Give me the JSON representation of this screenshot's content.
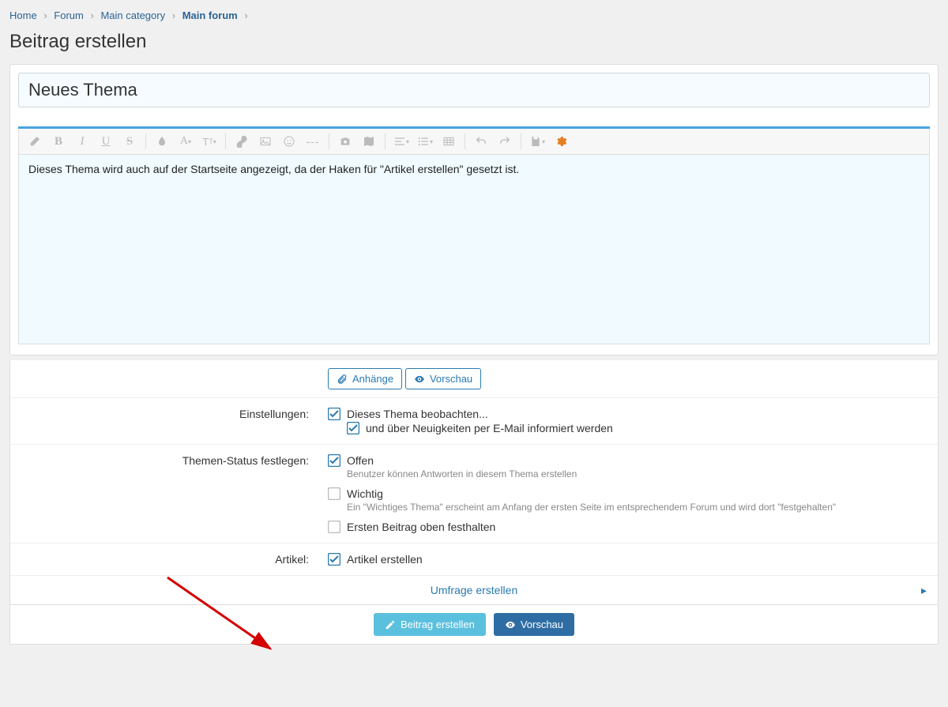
{
  "breadcrumb": {
    "items": [
      {
        "label": "Home"
      },
      {
        "label": "Forum"
      },
      {
        "label": "Main category"
      },
      {
        "label": "Main forum",
        "current": true
      }
    ]
  },
  "page_title": "Beitrag erstellen",
  "subject": {
    "value": "Neues Thema"
  },
  "editor": {
    "content": "Dieses Thema wird auch auf der Startseite angezeigt, da der Haken für \"Artikel erstellen\" gesetzt ist."
  },
  "buttons": {
    "attachments": "Anhänge",
    "preview_small": "Vorschau",
    "submit": "Beitrag erstellen",
    "preview_footer": "Vorschau"
  },
  "sections": {
    "settings_label": "Einstellungen:",
    "status_label": "Themen-Status festlegen:",
    "article_label": "Artikel:",
    "survey_label": "Umfrage erstellen"
  },
  "options": {
    "watch": {
      "label": "Dieses Thema beobachten...",
      "checked": true
    },
    "email": {
      "label": "und über Neuigkeiten per E-Mail informiert werden",
      "checked": true
    },
    "open": {
      "label": "Offen",
      "desc": "Benutzer können Antworten in diesem Thema erstellen",
      "checked": true
    },
    "important": {
      "label": "Wichtig",
      "desc": "Ein \"Wichtiges Thema\" erscheint am Anfang der ersten Seite im entsprechendem Forum und wird dort \"festgehalten\"",
      "checked": false
    },
    "pin_first": {
      "label": "Ersten Beitrag oben festhalten",
      "checked": false
    },
    "create_article": {
      "label": "Artikel erstellen",
      "checked": true
    }
  },
  "toolbar_icons": [
    "eraser",
    "bold",
    "italic",
    "underline",
    "strike",
    "sep",
    "drop",
    "font-color",
    "font-size",
    "sep",
    "link",
    "image",
    "smiley",
    "hr",
    "sep",
    "camera",
    "map",
    "sep",
    "align",
    "list",
    "table",
    "sep",
    "undo",
    "redo",
    "sep",
    "save",
    "settings"
  ]
}
